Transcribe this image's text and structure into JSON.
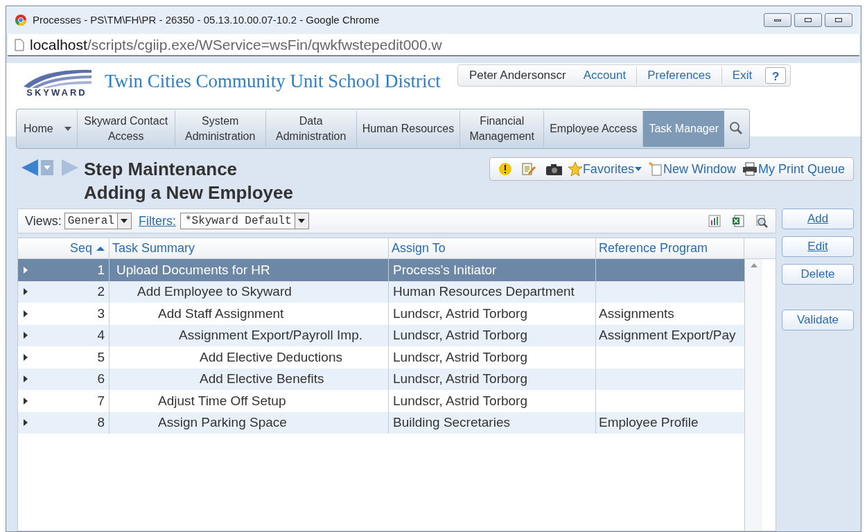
{
  "window": {
    "title": "Processes - PS\\TM\\FH\\PR - 26350 - 05.13.10.00.07-10.2 - Google Chrome",
    "url_host": "localhost",
    "url_path": "/scripts/cgiip.exe/WService=wsFin/qwkfwstepedit000.w"
  },
  "header": {
    "logo_text": "SKYWARD",
    "district": "Twin Cities Community Unit School District",
    "user": "Peter Andersonscr",
    "links": [
      "Account",
      "Preferences",
      "Exit"
    ],
    "help": "?"
  },
  "nav": [
    {
      "label": "Home",
      "selected": false,
      "dropdown": true
    },
    {
      "label": "Skyward Contact Access",
      "selected": false
    },
    {
      "label": "System Administration",
      "selected": false
    },
    {
      "label": "Data Administration",
      "selected": false
    },
    {
      "label": "Human Resources",
      "selected": false
    },
    {
      "label": "Financial Management",
      "selected": false
    },
    {
      "label": "Employee Access",
      "selected": false
    },
    {
      "label": "Task Manager",
      "selected": true
    }
  ],
  "page": {
    "title": "Step Maintenance",
    "subtitle": "Adding a New Employee"
  },
  "toolbar": {
    "favorites": "Favorites",
    "new_window": "New Window",
    "print_queue": "My Print Queue"
  },
  "filters": {
    "views_label": "Views:",
    "views_value": "General",
    "filters_label": "Filters:",
    "filters_value": "*Skyward Default"
  },
  "table": {
    "columns": [
      {
        "label": "Seq",
        "sorted": true
      },
      {
        "label": "Task Summary",
        "sorted": false
      },
      {
        "label": "Assign To",
        "sorted": false
      },
      {
        "label": "Reference Program",
        "sorted": false
      }
    ],
    "rows": [
      {
        "seq": "1",
        "summary": "Upload Documents for HR",
        "assign_to": "Process's Initiator",
        "selected": true,
        "children": [
          {
            "seq": "2",
            "summary": "Add Employee to Skyward",
            "assign_to": "Human Resources Department",
            "selected": false,
            "children": [
              {
                "seq": "3",
                "summary": "Add Staff Assignment",
                "assign_to": "Lundscr, Astrid Torborg",
                "reference": "Assignments",
                "selected": false,
                "children": [
                  {
                    "seq": "4",
                    "summary": "Assignment Export/Payroll Imp.",
                    "assign_to": "Lundscr, Astrid Torborg",
                    "reference": "Assignment Export/Pay",
                    "selected": false,
                    "children": [
                      {
                        "seq": "5",
                        "summary": "Add Elective Deductions",
                        "assign_to": "Lundscr, Astrid Torborg",
                        "selected": false
                      },
                      {
                        "seq": "6",
                        "summary": "Add Elective Benefits",
                        "assign_to": "Lundscr, Astrid Torborg",
                        "selected": false
                      }
                    ]
                  }
                ]
              },
              {
                "seq": "7",
                "summary": "Adjust Time Off Setup",
                "assign_to": "Lundscr, Astrid Torborg",
                "selected": false
              },
              {
                "seq": "8",
                "summary": "Assign Parking Space",
                "assign_to": "Building Secretaries",
                "reference": "Employee Profile",
                "selected": false
              }
            ]
          }
        ]
      }
    ]
  },
  "buttons": [
    {
      "label": "Add",
      "kind": "action"
    },
    {
      "label": "Edit",
      "kind": "action"
    },
    {
      "label": "Delete",
      "kind": "action"
    },
    {
      "label": "Validate",
      "kind": "spaced"
    }
  ]
}
